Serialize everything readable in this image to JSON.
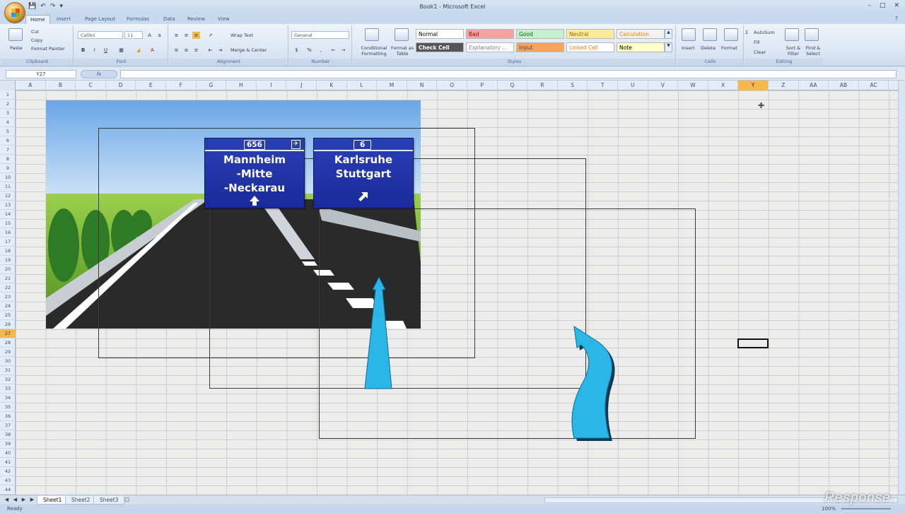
{
  "window": {
    "title": "Book1 - Microsoft Excel"
  },
  "quick_access": [
    "save-icon",
    "undo-icon",
    "redo-icon",
    "customize-icon"
  ],
  "tabs": [
    "Home",
    "Insert",
    "Page Layout",
    "Formulas",
    "Data",
    "Review",
    "View"
  ],
  "ribbon": {
    "clipboard": {
      "paste": "Paste",
      "cut": "Cut",
      "copy": "Copy",
      "format_painter": "Format Painter",
      "label": "Clipboard"
    },
    "font": {
      "name": "Calibri",
      "size": "11",
      "label": "Font",
      "bold": "B",
      "italic": "I",
      "underline": "U"
    },
    "alignment": {
      "wrap": "Wrap Text",
      "merge": "Merge & Center",
      "label": "Alignment"
    },
    "number": {
      "format": "General",
      "label": "Number",
      "percent": "%",
      "comma": ","
    },
    "styles": {
      "conditional": "Conditional Formatting",
      "format_table": "Format as Table",
      "cells": [
        {
          "text": "Normal",
          "bg": "#ffffff",
          "fg": "#000000"
        },
        {
          "text": "Bad",
          "bg": "#f4a3a3",
          "fg": "#9c0006"
        },
        {
          "text": "Good",
          "bg": "#c6efce",
          "fg": "#006100"
        },
        {
          "text": "Neutral",
          "bg": "#ffeb9c",
          "fg": "#9c6500"
        },
        {
          "text": "Calculation",
          "bg": "#f2f2f2",
          "fg": "#fa7d00"
        },
        {
          "text": "Check Cell",
          "bg": "#a5a5a5",
          "fg": "#ffffff"
        },
        {
          "text": "Explanatory ...",
          "bg": "#ffffff",
          "fg": "#7f7f7f"
        },
        {
          "text": "Input",
          "bg": "#f7a35c",
          "fg": "#3f3f76"
        },
        {
          "text": "Linked Cell",
          "bg": "#ffffff",
          "fg": "#fa7d00"
        },
        {
          "text": "Note",
          "bg": "#ffffcc",
          "fg": "#000000"
        }
      ],
      "label": "Styles"
    },
    "cells": {
      "insert": "Insert",
      "delete": "Delete",
      "format": "Format",
      "label": "Cells"
    },
    "editing": {
      "autosum": "AutoSum",
      "fill": "Fill",
      "clear": "Clear",
      "sort": "Sort & Filter",
      "find": "Find & Select",
      "label": "Editing"
    }
  },
  "formula_bar": {
    "name_box": "Y27",
    "fx": "fx",
    "value": ""
  },
  "columns": [
    "A",
    "B",
    "C",
    "D",
    "E",
    "F",
    "G",
    "H",
    "I",
    "J",
    "K",
    "L",
    "M",
    "N",
    "O",
    "P",
    "Q",
    "R",
    "S",
    "T",
    "U",
    "V",
    "W",
    "X",
    "Y",
    "Z",
    "AA",
    "AB",
    "AC"
  ],
  "selected_column": "Y",
  "selected_row": 27,
  "row_count": 44,
  "signs": [
    {
      "route": "656",
      "lines": [
        "Mannheim",
        "-Mitte",
        "-Neckarau"
      ],
      "arrow": "straight"
    },
    {
      "route": "6",
      "lines": [
        "Karlsruhe",
        "Stuttgart"
      ],
      "arrow": "diagonal-right"
    }
  ],
  "sheets": [
    "Sheet1",
    "Sheet2",
    "Sheet3"
  ],
  "active_sheet": "Sheet1",
  "status": {
    "ready": "Ready",
    "zoom": "100%"
  },
  "watermark": "Response.",
  "colors": {
    "sign_blue": "#1f31a8",
    "arrow_cyan": "#2ab6e6",
    "accent_selected": "#f4b94a"
  }
}
